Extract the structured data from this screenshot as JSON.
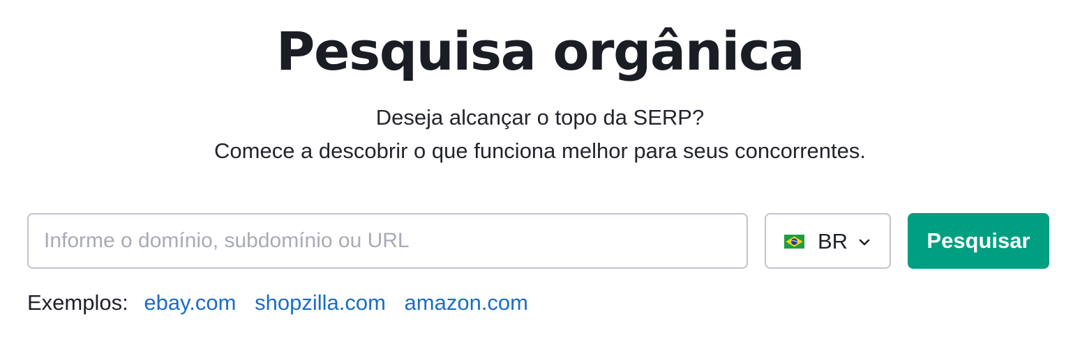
{
  "page": {
    "title": "Pesquisa orgânica",
    "subtitle_line1": "Deseja alcançar o topo da SERP?",
    "subtitle_line2": "Comece a descobrir o que funciona melhor para seus concorrentes."
  },
  "search": {
    "placeholder": "Informe o domínio, subdomínio ou URL",
    "value": "",
    "button_label": "Pesquisar"
  },
  "database": {
    "selected": "BR",
    "flag_icon": "brazil-flag-icon",
    "dropdown_icon": "chevron-down-icon"
  },
  "examples": {
    "label": "Exemplos:",
    "links": [
      "ebay.com",
      "shopzilla.com",
      "amazon.com"
    ]
  },
  "colors": {
    "accent": "#009f81",
    "link": "#1a6dc7",
    "text": "#1f2129",
    "border": "#c2c4cb",
    "placeholder": "#a9abb4"
  }
}
